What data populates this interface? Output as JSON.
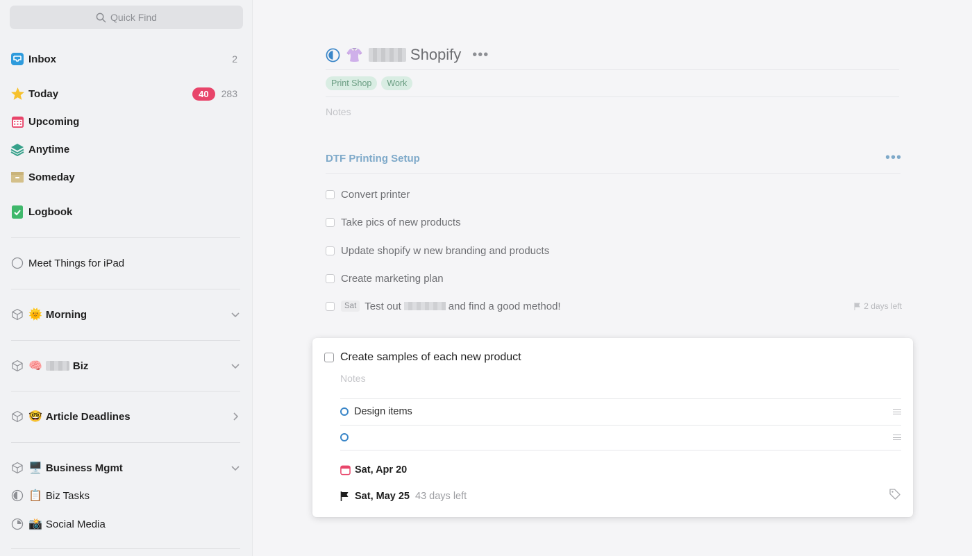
{
  "search": {
    "placeholder": "Quick Find"
  },
  "sidebar": {
    "inbox": {
      "label": "Inbox",
      "count": "2"
    },
    "today": {
      "label": "Today",
      "badge": "40",
      "count": "283"
    },
    "upcoming": {
      "label": "Upcoming"
    },
    "anytime": {
      "label": "Anytime"
    },
    "someday": {
      "label": "Someday"
    },
    "logbook": {
      "label": "Logbook"
    },
    "meet": {
      "label": "Meet Things for iPad"
    },
    "areas": [
      {
        "emoji": "🌞",
        "label": "Morning"
      },
      {
        "emoji": "🧠",
        "label": "Biz"
      },
      {
        "emoji": "🤓",
        "label": "Article Deadlines"
      },
      {
        "emoji": "🖥️",
        "label": "Business Mgmt"
      }
    ],
    "projects": [
      {
        "emoji": "📋",
        "label": "Biz Tasks"
      },
      {
        "emoji": "📸",
        "label": "Social Media"
      }
    ]
  },
  "project": {
    "emoji": "👚",
    "title": "Shopify",
    "more": "•••",
    "tags": [
      "Print Shop",
      "Work"
    ],
    "notes_placeholder": "Notes"
  },
  "heading": {
    "title": "DTF Printing Setup",
    "more": "•••"
  },
  "todos": [
    {
      "label": "Convert printer"
    },
    {
      "label": "Take pics of new products"
    },
    {
      "label": "Update shopify w new branding and products"
    },
    {
      "label": "Create marketing plan"
    }
  ],
  "todo_special": {
    "when": "Sat",
    "label_start": "Test out",
    "label_end": "and find a good method!",
    "deadline": "2 days left"
  },
  "card": {
    "title": "Create samples of each new product",
    "notes_placeholder": "Notes",
    "checklist": [
      {
        "label": "Design items"
      },
      {
        "label": ""
      }
    ],
    "when_date": "Sat, Apr 20",
    "deadline_date": "Sat, May 25",
    "deadline_left": "43 days left"
  },
  "colors": {
    "accent_blue": "#3a86c8",
    "heading_blue": "#7ea9c9",
    "badge_red": "#e8456a",
    "tag_green_bg": "#d9ede3"
  }
}
